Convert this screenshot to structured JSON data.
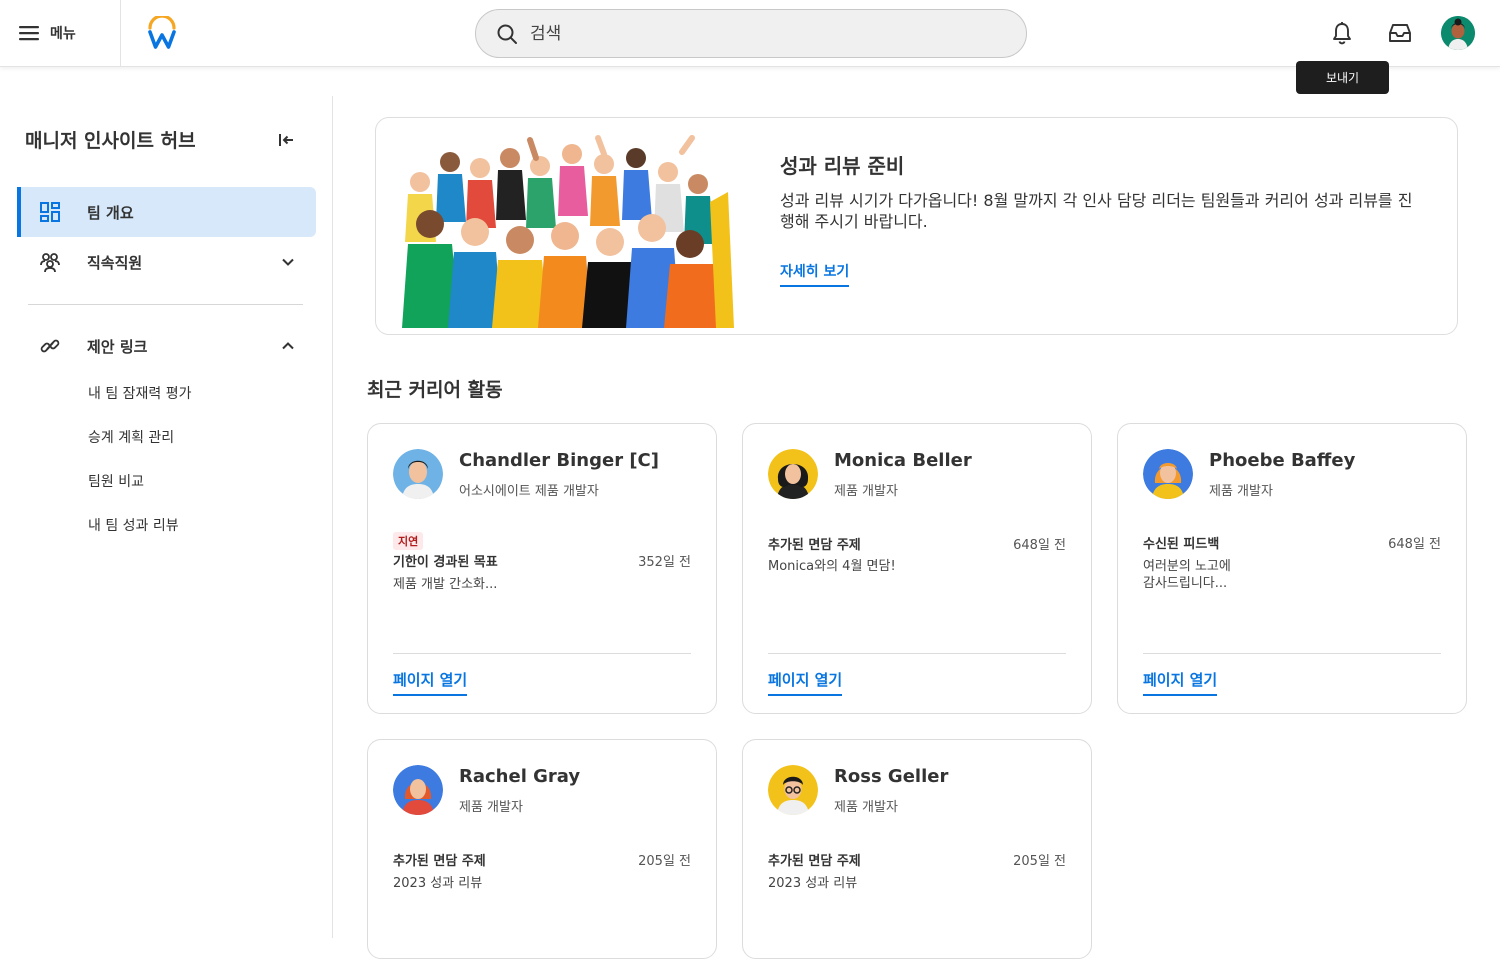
{
  "topbar": {
    "menu_label": "메뉴",
    "search_placeholder": "검색",
    "tooltip": "보내기",
    "icons": [
      "hamburger-icon",
      "workday-logo",
      "search-icon",
      "bell-icon",
      "inbox-icon",
      "user-avatar"
    ]
  },
  "sidebar": {
    "title": "매니저 인사이트 허브",
    "items": [
      {
        "label": "팀 개요",
        "icon": "dashboard-icon",
        "active": true
      },
      {
        "label": "직속직원",
        "icon": "people-icon",
        "active": false
      },
      {
        "label": "제안 링크",
        "icon": "link-icon",
        "active": false
      }
    ],
    "links": [
      "내 팀 잠재력 평가",
      "승계 계획 관리",
      "팀원 비교",
      "내 팀 성과 리뷰"
    ]
  },
  "banner": {
    "title": "성과 리뷰 준비",
    "text": "성과 리뷰 시기가 다가옵니다! 8월 말까지 각 인사 담당 리더는 팀원들과 커리어 성과 리뷰를 진행해 주시기 바랍니다.",
    "link": "자세히 보기"
  },
  "section_title": "최근 커리어 활동",
  "cards": [
    {
      "name": "Chandler Binger [C]",
      "role": "어소시에이트 제품 개발자",
      "badge": "지연",
      "activity": "기한이 경과된 목표",
      "time": "352일 전",
      "desc": "제품 개발 간소화...",
      "link": "페이지 열기"
    },
    {
      "name": "Monica Beller",
      "role": "제품 개발자",
      "activity": "추가된 면담 주제",
      "time": "648일 전",
      "desc": "Monica와의 4월 면담!",
      "link": "페이지 열기"
    },
    {
      "name": "Phoebe Baffey",
      "role": "제품 개발자",
      "activity": "수신된 피드백",
      "time": "648일 전",
      "desc": "여러분의 노고에\n감사드립니다...",
      "link": "페이지 열기"
    },
    {
      "name": "Rachel Gray",
      "role": "제품 개발자",
      "activity": "추가된 면담 주제",
      "time": "205일 전",
      "desc": "2023 성과 리뷰"
    },
    {
      "name": "Ross Geller",
      "role": "제품 개발자",
      "activity": "추가된 면담 주제",
      "time": "205일 전",
      "desc": "2023 성과 리뷰"
    }
  ],
  "colors": {
    "accent": "#0875e1",
    "active_bg": "#d7e8fb",
    "badge_red": "#b11b1b"
  }
}
